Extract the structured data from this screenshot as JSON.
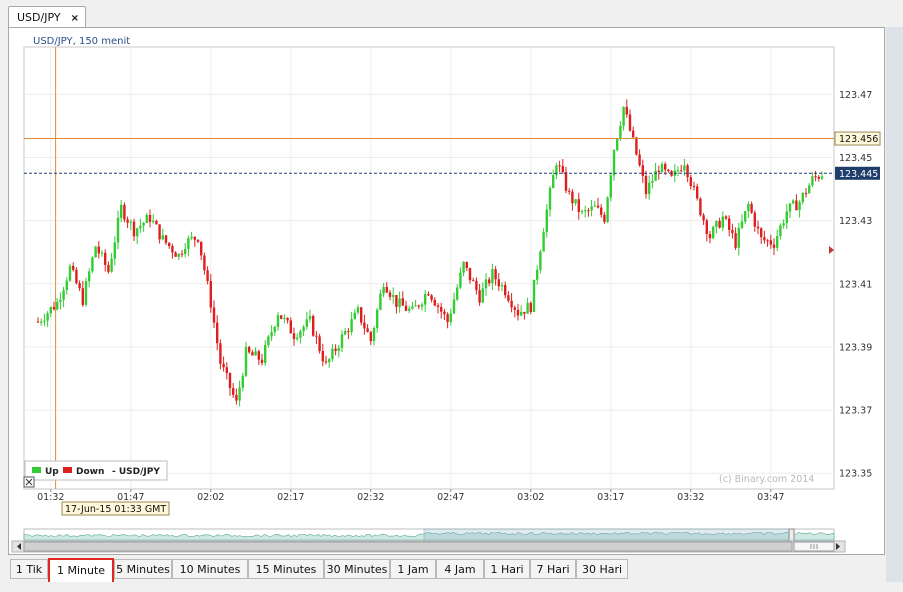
{
  "tab": {
    "label": "USD/JPY",
    "close": "×"
  },
  "chart": {
    "title": "USD/JPY, 150 menit",
    "watermark": "(c) Binary.com 2014",
    "legend": {
      "up": "Up",
      "down": "Down",
      "pair": "- USD/JPY"
    },
    "crosshair_time": "17-Jun-15 01:33 GMT",
    "crosshair_price": "123.456",
    "last_price": "123.445",
    "colors": {
      "up": "#33cc33",
      "down": "#dd1f1f",
      "crosshair": "#e08a3c",
      "last": "#1e3d6b",
      "navigator": "#cfe9e2"
    }
  },
  "timeframes": [
    "1 Tik",
    "1 Minute",
    "5 Minutes",
    "10 Minutes",
    "15 Minutes",
    "30 Minutes",
    "1 Jam",
    "4 Jam",
    "1 Hari",
    "7 Hari",
    "30 Hari"
  ],
  "selected_timeframe": "1 Minute",
  "chart_data": {
    "type": "candlestick",
    "title": "USD/JPY, 150 menit",
    "x_ticks": [
      "01:32",
      "01:47",
      "02:02",
      "02:17",
      "02:32",
      "02:47",
      "03:02",
      "03:17",
      "03:32",
      "03:47"
    ],
    "y_ticks": [
      123.35,
      123.37,
      123.39,
      123.41,
      123.43,
      123.45,
      123.47
    ],
    "ylim": [
      123.345,
      123.485
    ],
    "crosshair": {
      "time": "01:33",
      "price": 123.456
    },
    "last_price": 123.445,
    "legend": [
      "Up",
      "Down"
    ],
    "grid": true,
    "close_path": [
      [
        0,
        123.398
      ],
      [
        6,
        123.404
      ],
      [
        10,
        123.415
      ],
      [
        14,
        123.405
      ],
      [
        18,
        123.422
      ],
      [
        22,
        123.414
      ],
      [
        26,
        123.434
      ],
      [
        30,
        123.427
      ],
      [
        35,
        123.431
      ],
      [
        39,
        123.424
      ],
      [
        44,
        123.419
      ],
      [
        46,
        123.423
      ],
      [
        50,
        123.425
      ],
      [
        54,
        123.404
      ],
      [
        57,
        123.385
      ],
      [
        62,
        123.372
      ],
      [
        65,
        123.388
      ],
      [
        70,
        123.386
      ],
      [
        75,
        123.401
      ],
      [
        80,
        123.394
      ],
      [
        85,
        123.398
      ],
      [
        90,
        123.384
      ],
      [
        95,
        123.393
      ],
      [
        100,
        123.401
      ],
      [
        104,
        123.392
      ],
      [
        108,
        123.411
      ],
      [
        112,
        123.404
      ],
      [
        117,
        123.401
      ],
      [
        122,
        123.408
      ],
      [
        128,
        123.398
      ],
      [
        133,
        123.416
      ],
      [
        138,
        123.406
      ],
      [
        142,
        123.413
      ],
      [
        146,
        123.408
      ],
      [
        150,
        123.401
      ],
      [
        154,
        123.403
      ],
      [
        158,
        123.428
      ],
      [
        162,
        123.449
      ],
      [
        166,
        123.438
      ],
      [
        170,
        123.432
      ],
      [
        174,
        123.434
      ],
      [
        177,
        123.431
      ],
      [
        180,
        123.453
      ],
      [
        183,
        123.466
      ],
      [
        187,
        123.451
      ],
      [
        190,
        123.439
      ],
      [
        194,
        123.447
      ],
      [
        198,
        123.443
      ],
      [
        202,
        123.449
      ],
      [
        206,
        123.436
      ],
      [
        210,
        123.425
      ],
      [
        214,
        123.431
      ],
      [
        218,
        123.423
      ],
      [
        222,
        123.435
      ],
      [
        226,
        123.424
      ],
      [
        230,
        123.423
      ],
      [
        234,
        123.433
      ],
      [
        238,
        123.436
      ],
      [
        242,
        123.443
      ],
      [
        245,
        123.445
      ]
    ]
  }
}
